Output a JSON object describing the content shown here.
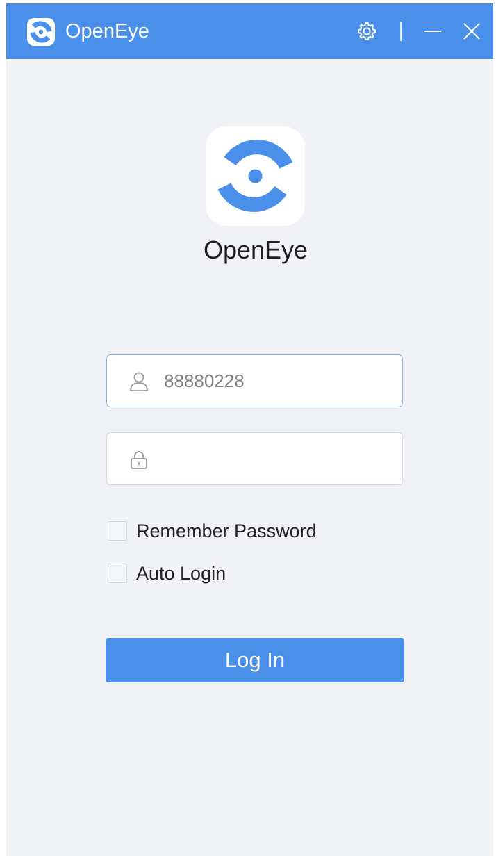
{
  "window": {
    "title": "OpenEye",
    "controls": {
      "settings_icon": "gear-icon",
      "minimize_icon": "minimize-icon",
      "close_icon": "close-icon"
    }
  },
  "brand": {
    "app_name": "OpenEye",
    "logo_icon": "openeye-logo",
    "accent_color": "#4a8fea"
  },
  "form": {
    "username": {
      "icon": "user-icon",
      "value": "88880228",
      "placeholder": ""
    },
    "password": {
      "icon": "lock-icon",
      "value": "",
      "placeholder": ""
    },
    "remember_password": {
      "label": "Remember Password",
      "checked": false
    },
    "auto_login": {
      "label": "Auto Login",
      "checked": false
    },
    "login_button": {
      "label": "Log In"
    }
  }
}
